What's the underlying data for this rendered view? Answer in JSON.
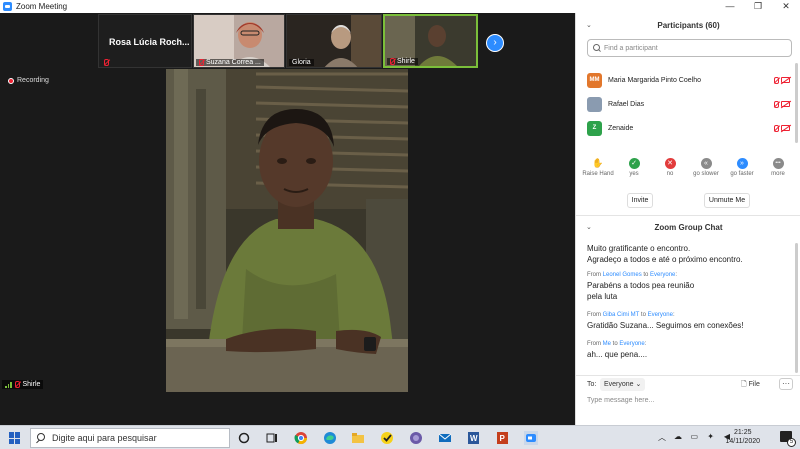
{
  "window": {
    "title": "Zoom Meeting",
    "controls": [
      "—",
      "❐",
      "✕"
    ]
  },
  "strip": {
    "tiles": [
      {
        "name": "Rosa Lúcia Roch...",
        "caption": ""
      },
      {
        "name": "",
        "caption": "Suzana Correa ..."
      },
      {
        "name": "",
        "caption": "Gloria"
      },
      {
        "name": "",
        "caption": "Shirle"
      }
    ],
    "next_label": "›"
  },
  "recording": "Recording",
  "main_video": {
    "caption": "Shirle"
  },
  "participants": {
    "title": "Participants (60)",
    "search_placeholder": "Find a participant",
    "list": [
      {
        "initials": "MM",
        "name": "Maria Margarida Pinto Coelho",
        "color": "#e2772c"
      },
      {
        "initials": "",
        "name": "Rafael Dias",
        "color": "#8a9bb0"
      },
      {
        "initials": "Z",
        "name": "Zenaide",
        "color": "#2ea24b"
      }
    ],
    "reactions": [
      {
        "label": "Raise Hand",
        "glyph": "✋",
        "color": "#2d8cff"
      },
      {
        "label": "yes",
        "glyph": "✓",
        "color": "#2ea24b"
      },
      {
        "label": "no",
        "glyph": "✕",
        "color": "#e23c3c"
      },
      {
        "label": "go slower",
        "glyph": "«",
        "color": "#8a8a8a"
      },
      {
        "label": "go faster",
        "glyph": "»",
        "color": "#2d8cff"
      },
      {
        "label": "more",
        "glyph": "•••",
        "color": "#8a8a8a"
      }
    ],
    "invite_label": "Invite",
    "unmute_label": "Unmute Me"
  },
  "chat": {
    "title": "Zoom Group Chat",
    "messages": [
      {
        "from_prefix": "",
        "from_name": "",
        "to": "",
        "lines": [
          "Muito gratificante o encontro.",
          "Agradeço a todos e até o próximo encontro."
        ]
      },
      {
        "from_prefix": "From",
        "from_name": "Leonel Gomes",
        "to": "Everyone",
        "lines": [
          "Parabéns a todos pea reunião",
          "pela luta"
        ]
      },
      {
        "from_prefix": "From",
        "from_name": "Giba Cimi MT",
        "to": "Everyone",
        "lines": [
          "Gratidão Suzana... Seguimos em conexões!"
        ]
      },
      {
        "from_prefix": "From",
        "from_name": "Me",
        "to": "Everyone",
        "lines": [
          "ah... que pena...."
        ]
      }
    ],
    "to_label": "To:",
    "to_value": "Everyone ⌄",
    "file_label": "File",
    "more_label": "···",
    "input_placeholder": "Type message here..."
  },
  "taskbar": {
    "search_placeholder": "Digite aqui para pesquisar",
    "time": "21:25",
    "date": "14/11/2020",
    "notification_count": "5"
  }
}
